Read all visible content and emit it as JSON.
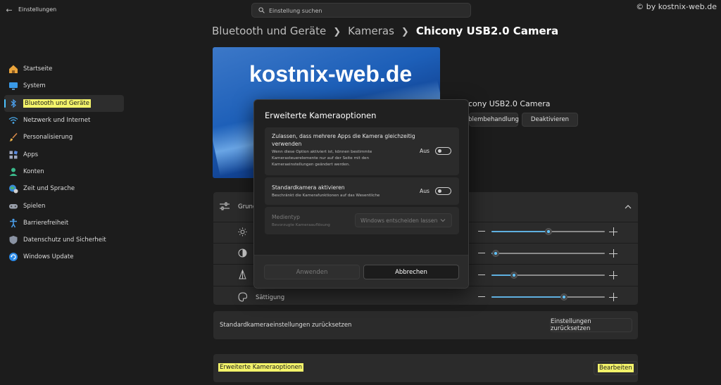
{
  "window": {
    "title": "Einstellungen",
    "watermark": "© by kostnix-web.de"
  },
  "search": {
    "placeholder": "Einstellung suchen"
  },
  "breadcrumb": {
    "parts": [
      "Bluetooth und Geräte",
      "Kameras",
      "Chicony USB2.0 Camera"
    ]
  },
  "sidebar": {
    "items": [
      {
        "label": "Startseite",
        "icon": "home-icon"
      },
      {
        "label": "System",
        "icon": "monitor-icon"
      },
      {
        "label": "Bluetooth und Geräte",
        "icon": "bluetooth-icon",
        "active": true
      },
      {
        "label": "Netzwerk und Internet",
        "icon": "wifi-icon"
      },
      {
        "label": "Personalisierung",
        "icon": "brush-icon"
      },
      {
        "label": "Apps",
        "icon": "apps-icon"
      },
      {
        "label": "Konten",
        "icon": "person-icon"
      },
      {
        "label": "Zeit und Sprache",
        "icon": "globe-clock-icon"
      },
      {
        "label": "Spielen",
        "icon": "gamepad-icon"
      },
      {
        "label": "Barrierefreiheit",
        "icon": "accessibility-icon"
      },
      {
        "label": "Datenschutz und Sicherheit",
        "icon": "shield-icon"
      },
      {
        "label": "Windows Update",
        "icon": "update-icon"
      }
    ]
  },
  "camera": {
    "preview_text": "kostnix-web.de",
    "device_name_partial": "cony USB2.0 Camera",
    "troubleshoot_partial": "blembehandlung",
    "deactivate_label": "Deaktivieren"
  },
  "basic_settings": {
    "header_partial": "Grund",
    "saturation_label": "Sättigung",
    "sliders": [
      {
        "name": "brightness",
        "icon": "brightness-icon",
        "value": 0.5
      },
      {
        "name": "contrast",
        "icon": "contrast-icon",
        "value": 0.04
      },
      {
        "name": "sharpness",
        "icon": "sharpness-icon",
        "value": 0.2
      },
      {
        "name": "saturation",
        "icon": "saturation-icon",
        "value": 0.64
      }
    ]
  },
  "reset": {
    "label": "Standardkameraeinstellungen zurücksetzen",
    "button": "Einstellungen zurücksetzen"
  },
  "advanced": {
    "label": "Erweiterte Kameraoptionen",
    "button": "Bearbeiten"
  },
  "dialog": {
    "title": "Erweiterte Kameraoptionen",
    "multi_app": {
      "title_line1": "Zulassen, dass mehrere Apps die Kamera gleichzeitig",
      "title_line2": "verwenden",
      "desc_line1": "Wenn diese Option aktiviert ist, können bestimmte",
      "desc_line2": "Kamerasteuerelemente nur auf der Seite mit den",
      "desc_line3": "Kameraeinstellungen geändert werden.",
      "state": "Aus"
    },
    "default_camera": {
      "title": "Standardkamera aktivieren",
      "desc": "Beschränkt die Kamerafunktionen auf das Wesentliche",
      "state": "Aus"
    },
    "media_type": {
      "title": "Medientyp",
      "desc": "Bevorzugte Kameraauflösung",
      "selected": "Windows entscheiden lassen"
    },
    "apply_label": "Anwenden",
    "cancel_label": "Abbrechen"
  },
  "colors": {
    "accent": "#4cc2ff",
    "highlight": "#f3f36a",
    "background": "#1c1c1c",
    "card": "#2b2b2b"
  }
}
